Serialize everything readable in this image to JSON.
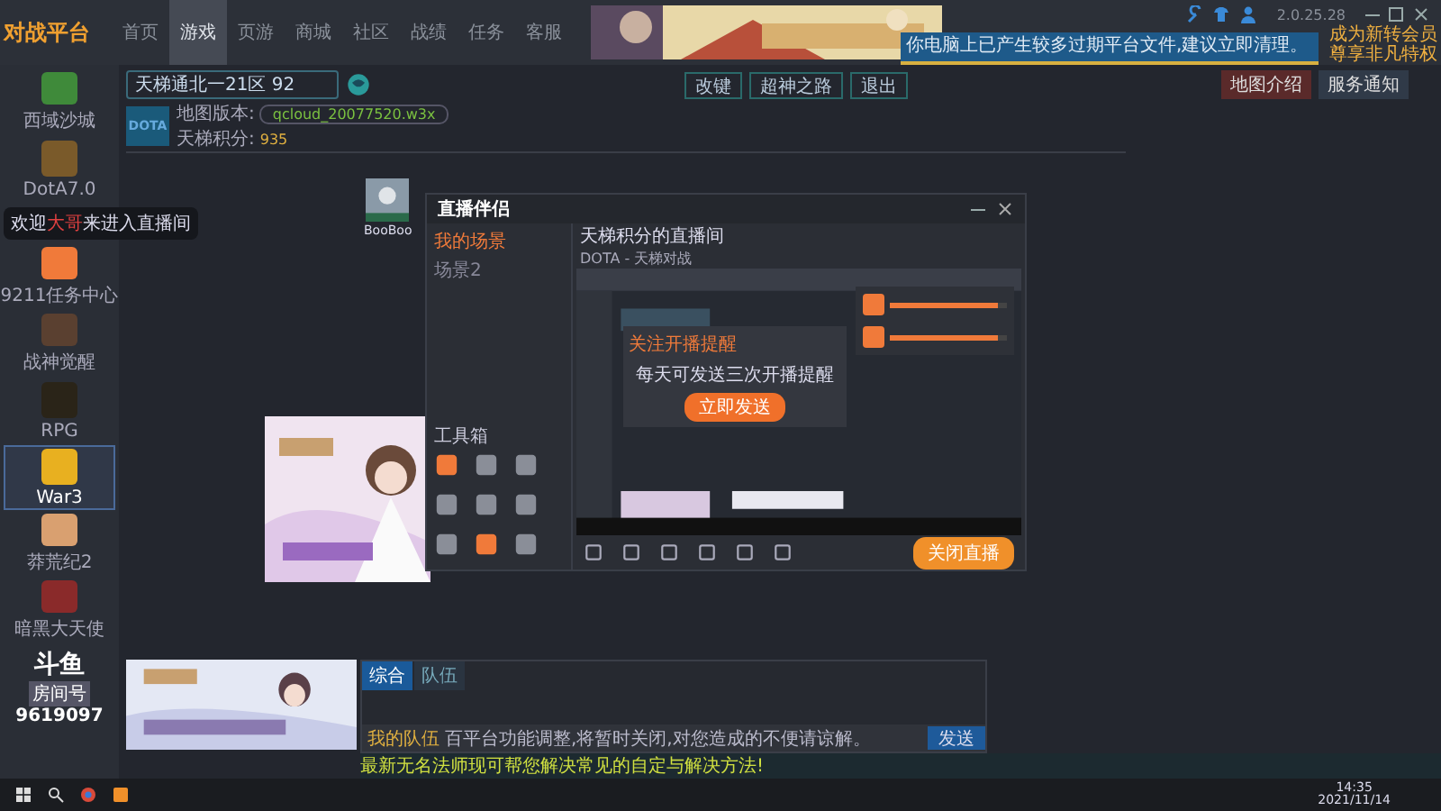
{
  "app": {
    "logo": "对战平台",
    "version": "2.0.25.28",
    "tooltip": "你电脑上已产生较多过期平台文件,建议立即清理。",
    "vip_badge": "成为新转会员尊享非凡特权"
  },
  "nav": [
    {
      "label": "首页",
      "selected": false
    },
    {
      "label": "游戏",
      "selected": true
    },
    {
      "label": "页游",
      "selected": false
    },
    {
      "label": "商城",
      "selected": false
    },
    {
      "label": "社区",
      "selected": false
    },
    {
      "label": "战绩",
      "selected": false
    },
    {
      "label": "任务",
      "selected": false
    },
    {
      "label": "客服",
      "selected": false
    }
  ],
  "sidebar": {
    "games": [
      {
        "name": "西域沙城",
        "selected": false,
        "color": "#3f8a3a"
      },
      {
        "name": "DotA7.0",
        "selected": false,
        "color": "#7a5a2a"
      },
      {
        "name": "9211任务中心",
        "selected": false,
        "color": "#f07a3a"
      },
      {
        "name": "战神觉醒",
        "selected": false,
        "color": "#5a4030"
      },
      {
        "name": "RPG",
        "selected": false,
        "color": "#2a2418"
      },
      {
        "name": "War3",
        "selected": true,
        "color": "#e8b020"
      },
      {
        "name": "莽荒纪2",
        "selected": false,
        "color": "#d9a070"
      },
      {
        "name": "暗黑大天使",
        "selected": false,
        "color": "#8a2a2a"
      }
    ]
  },
  "douyu": {
    "logo": "斗鱼",
    "room_label": "房间号",
    "room_number": "9619097"
  },
  "welcome": "欢迎**大哥**来进入直播间",
  "room": {
    "name": "天梯通北一21区",
    "ping": "92",
    "buttons": [
      "改键",
      "超神之路",
      "退出"
    ],
    "right_buttons": [
      "地图介绍",
      "服务通知"
    ],
    "map_thumb": "DOTA",
    "map_label": "地图版本:",
    "map_value": "qcloud_20077520.w3x",
    "score_label": "天梯积分:",
    "score": "935",
    "player": "BooBoo"
  },
  "streamer": {
    "title": "直播伴侣",
    "tabs": [
      {
        "label": "我的场景",
        "selected": true
      },
      {
        "label": "场景2",
        "selected": false
      }
    ],
    "room_title": "天梯积分的直播间",
    "category": "DOTA - 天梯对战",
    "toolbox": "工具箱",
    "popup_title": "关注开播提醒",
    "popup_text": "每天可发送三次开播提醒",
    "popup_button": "立即发送",
    "tasks": [
      {
        "level": 0.92
      },
      {
        "level": 0.92
      }
    ],
    "live_button": "关闭直播"
  },
  "chat": {
    "tabs": [
      {
        "label": "综合",
        "selected": true
      },
      {
        "label": "队伍",
        "selected": false
      }
    ],
    "prefix": "我的队伍",
    "message": "百平台功能调整,将暂时关闭,对您造成的不便请谅解。",
    "send": "发送"
  },
  "notice": "最新无名法师现可帮您解决常见的自定与解决方法!",
  "taskbar": {
    "time": "14:35",
    "date": "2021/11/14"
  }
}
